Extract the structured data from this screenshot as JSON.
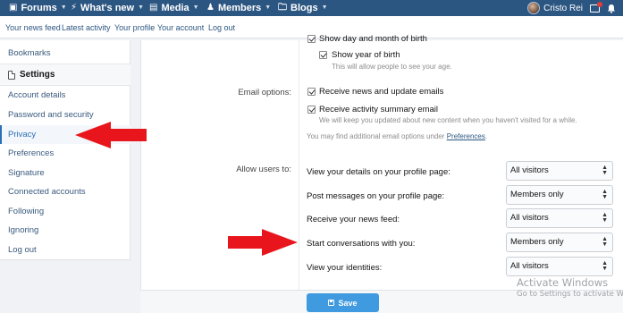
{
  "topnav": {
    "items": [
      {
        "label": "Forums",
        "icon": "comments-icon"
      },
      {
        "label": "What's new",
        "icon": "bolt-icon"
      },
      {
        "label": "Media",
        "icon": "image-icon"
      },
      {
        "label": "Members",
        "icon": "users-icon"
      },
      {
        "label": "Blogs",
        "icon": "folder-icon"
      }
    ],
    "username": "Cristo Rei"
  },
  "subnav": [
    "Your news feed",
    "Latest activity",
    "Your profile",
    "Your account",
    "Log out"
  ],
  "sidebar": {
    "bookmarks": "Bookmarks",
    "settings_header": "Settings",
    "items": [
      "Account details",
      "Password and security",
      "Privacy",
      "Preferences",
      "Signature",
      "Connected accounts",
      "Following",
      "Ignoring",
      "Log out"
    ],
    "active": "Privacy"
  },
  "form": {
    "show_day_month": "Show day and month of birth",
    "show_year": "Show year of birth",
    "show_year_hint": "This will allow people to see your age.",
    "email_label": "Email options:",
    "receive_news": "Receive news and update emails",
    "receive_summary": "Receive activity summary email",
    "summary_hint": "We will keep you updated about new content when you haven't visited for a while.",
    "more_options_prefix": "You may find additional email options under ",
    "more_options_link": "Preferences",
    "more_options_suffix": ".",
    "allow_label": "Allow users to:",
    "privacy_rows": [
      {
        "label": "View your details on your profile page:",
        "value": "All visitors"
      },
      {
        "label": "Post messages on your profile page:",
        "value": "Members only"
      },
      {
        "label": "Receive your news feed:",
        "value": "All visitors"
      },
      {
        "label": "Start conversations with you:",
        "value": "Members only"
      },
      {
        "label": "View your identities:",
        "value": "All visitors"
      }
    ],
    "save_label": "Save"
  },
  "watermark": {
    "title": "Activate Windows",
    "subtitle": "Go to Settings to activate Wind"
  },
  "colors": {
    "nav_bg": "#2c5682",
    "accent": "#3f9ae0",
    "annotation_arrow": "#e8161c"
  }
}
